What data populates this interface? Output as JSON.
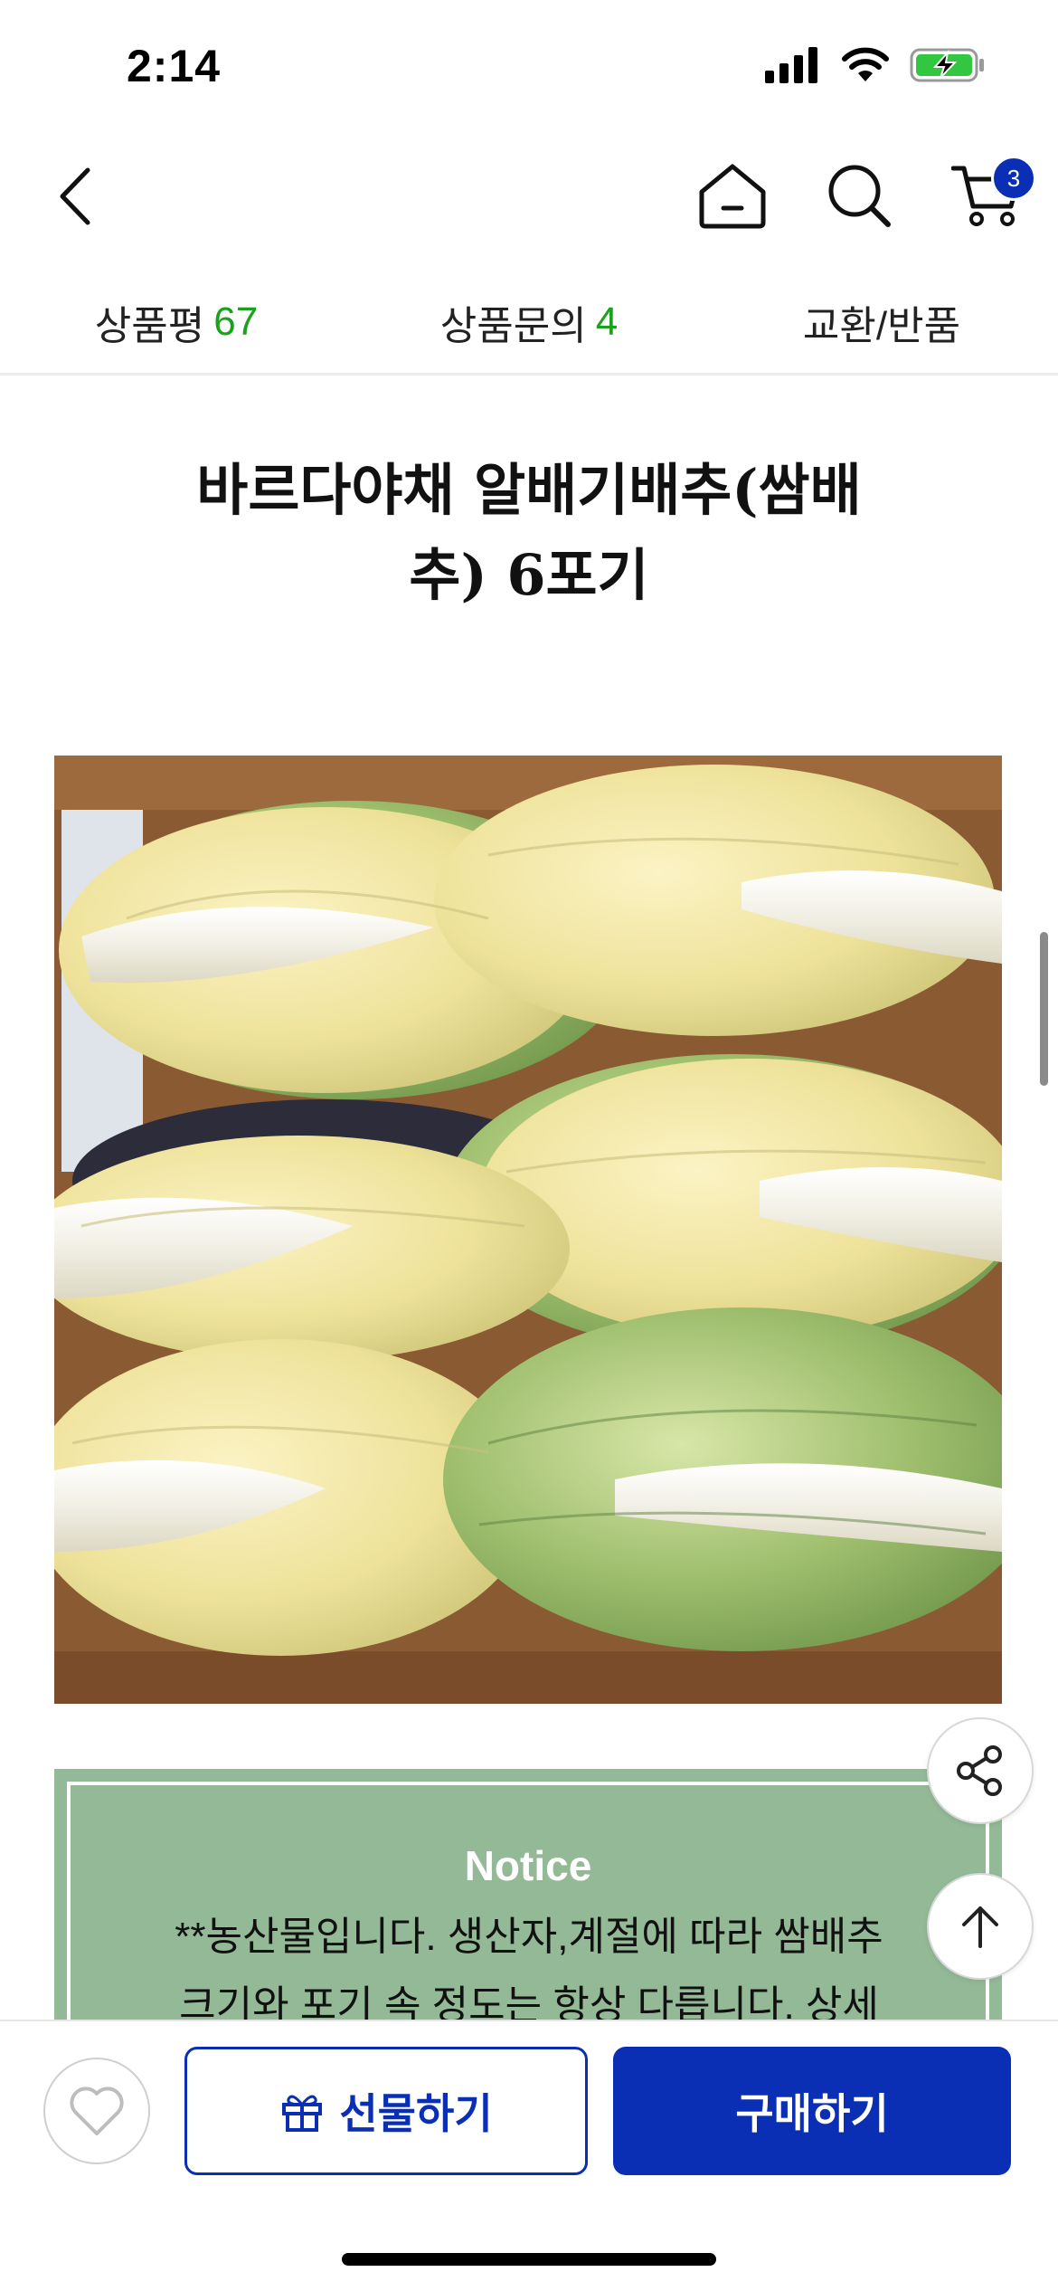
{
  "status_bar": {
    "time": "2:14"
  },
  "cart": {
    "badge_count": "3"
  },
  "tabs": [
    {
      "label": "상품평",
      "count": "67"
    },
    {
      "label": "상품문의",
      "count": "4"
    },
    {
      "label": "교환/반품",
      "count": ""
    }
  ],
  "product": {
    "title_line1": "바르다야채 알배기배추(쌈배",
    "title_line2": "추) 6포기",
    "image_alt": "napa-cabbage-box-photo"
  },
  "notice": {
    "title": "Notice",
    "body_line1": "**농산물입니다. 생산자,계절에 따라 쌈배추",
    "body_line2": "크기와 포기 속 정도는 항상 다릅니다. 상세"
  },
  "bottom_bar": {
    "gift_label": "선물하기",
    "buy_label": "구매하기"
  },
  "colors": {
    "brand_blue": "#0a2fb4",
    "count_green": "#1aa31a",
    "notice_green": "#93b997"
  },
  "icons": [
    "back-chevron-icon",
    "home-icon",
    "search-icon",
    "cart-icon",
    "share-icon",
    "arrow-up-icon",
    "heart-icon",
    "gift-icon",
    "signal-icon",
    "wifi-icon",
    "battery-charging-icon"
  ]
}
